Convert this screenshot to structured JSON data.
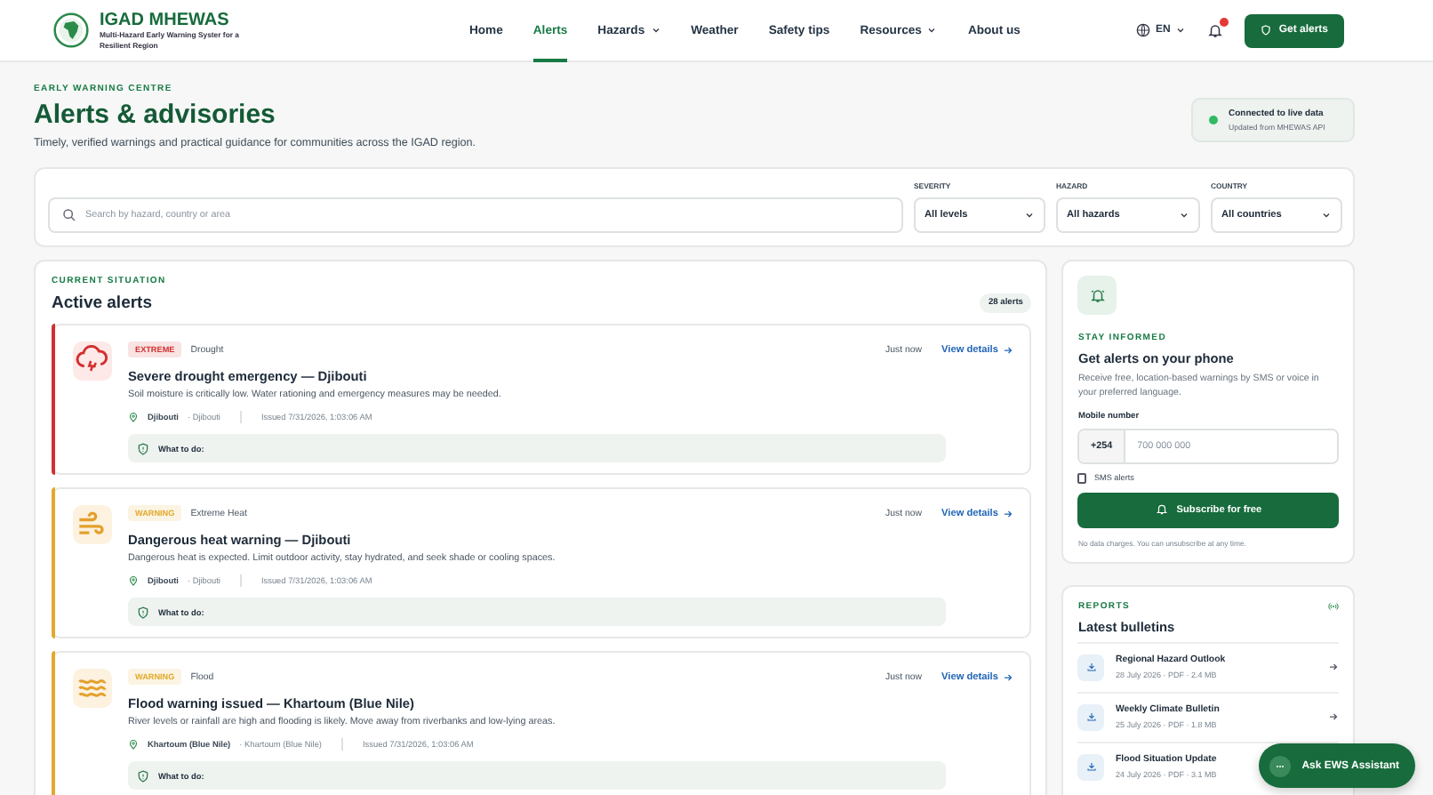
{
  "header": {
    "brand": {
      "name": "IGAD MHEWAS",
      "tagline": "Multi-Hazard Early Warning Syster for a Resilient Region"
    },
    "nav": [
      {
        "label": "Home",
        "selected": false,
        "dropdown": false
      },
      {
        "label": "Alerts",
        "selected": true,
        "dropdown": false
      },
      {
        "label": "Hazards",
        "selected": false,
        "dropdown": true
      },
      {
        "label": "Weather",
        "selected": false,
        "dropdown": false
      },
      {
        "label": "Safety tips",
        "selected": false,
        "dropdown": false
      },
      {
        "label": "Resources",
        "selected": false,
        "dropdown": true
      },
      {
        "label": "About us",
        "selected": false,
        "dropdown": false
      }
    ],
    "language": "EN",
    "notifications_unread": true,
    "cta": "Get alerts"
  },
  "page_header": {
    "eyebrow": "EARLY WARNING CENTRE",
    "title": "Alerts & advisories",
    "subtitle": "Timely, verified warnings and practical guidance for communities across the IGAD region.",
    "status": {
      "title": "Connected to live data",
      "detail": "Updated from MHEWAS API"
    }
  },
  "filters": {
    "search": {
      "placeholder": "Search by hazard, country or area"
    },
    "selects": [
      {
        "label": "SEVERITY",
        "value": "All levels"
      },
      {
        "label": "HAZARD",
        "value": "All hazards"
      },
      {
        "label": "COUNTRY",
        "value": "All countries"
      }
    ]
  },
  "alerts_panel": {
    "eyebrow": "CURRENT SITUATION",
    "title": "Active alerts",
    "count": "28 alerts",
    "alerts": [
      {
        "kind": "drought",
        "color": "#d32f2f",
        "severity": "EXTREME",
        "hazard": "Drought",
        "time": "Just now",
        "link": "View details",
        "title": "Severe drought emergency — Djibouti",
        "description": "Soil moisture is critically low. Water rationing and emergency measures may be needed.",
        "area": "Djibouti",
        "country": "· Djibouti",
        "issued": "Issued 7/31/2026, 1:03:06 AM",
        "guidance": "What to do:"
      },
      {
        "kind": "heat",
        "color": "#e3a92b",
        "severity": "WARNING",
        "hazard": "Extreme Heat",
        "time": "Just now",
        "link": "View details",
        "title": "Dangerous heat warning — Djibouti",
        "description": "Dangerous heat is expected. Limit outdoor activity, stay hydrated, and seek shade or cooling spaces.",
        "area": "Djibouti",
        "country": "· Djibouti",
        "issued": "Issued 7/31/2026, 1:03:06 AM",
        "guidance": "What to do:"
      },
      {
        "kind": "flood",
        "color": "#e3a92b",
        "severity": "WARNING",
        "hazard": "Flood",
        "time": "Just now",
        "link": "View details",
        "title": "Flood warning issued — Khartoum (Blue Nile)",
        "description": "River levels or rainfall are high and flooding is likely. Move away from riverbanks and low-lying areas.",
        "area": "Khartoum (Blue Nile)",
        "country": "· Khartoum (Blue Nile)",
        "issued": "Issued 7/31/2026, 1:03:06 AM",
        "guidance": "What to do:"
      }
    ]
  },
  "subscribe": {
    "eyebrow": "STAY INFORMED",
    "title": "Get alerts on your phone",
    "text": "Receive free, location-based warnings by SMS or voice in your preferred language.",
    "field_label": "Mobile number",
    "prefix": "+254",
    "placeholder": "700 000 000",
    "sms": {
      "label": "SMS alerts",
      "checked": false
    },
    "button": "Subscribe for free",
    "note": "No data charges. You can unsubscribe at any time."
  },
  "bulletins": {
    "eyebrow": "REPORTS",
    "title": "Latest bulletins",
    "items": [
      {
        "title": "Regional Hazard Outlook",
        "meta": "28 July 2026 · PDF · 2.4 MB"
      },
      {
        "title": "Weekly Climate Bulletin",
        "meta": "25 July 2026 · PDF · 1.8 MB"
      },
      {
        "title": "Flood Situation Update",
        "meta": "24 July 2026 · PDF · 3.1 MB"
      }
    ]
  },
  "assistant": {
    "label": "Ask EWS Assistant"
  }
}
